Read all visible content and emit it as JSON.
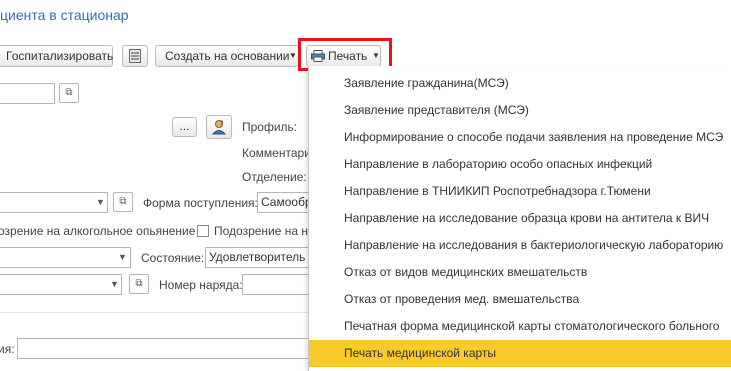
{
  "header": {
    "title_link": "циента в стационар"
  },
  "toolbar": {
    "hospitalize_label": "Госпитализировать",
    "create_based_label": "Создать на основании",
    "print_label": "Печать"
  },
  "form": {
    "profile_label": "Профиль:",
    "comment_label": "Комментари",
    "department_label": "Отделение:",
    "admission_form_label": "Форма поступления:",
    "admission_form_value": "Самообр",
    "alcohol_text": "озрение на алкогольное опьянение",
    "suspicion_text": "Подозрение на на",
    "state_label": "Состояние:",
    "state_value": "Удовлетворитель",
    "order_number_label": "Номер наряда:",
    "bottom_label": "ия:",
    "ellipsis": "..."
  },
  "print_menu": {
    "items": [
      "Заявление гражданина(МСЭ)",
      "Заявление представителя (МСЭ)",
      "Информирование о способе подачи заявления на проведение МСЭ",
      "Направление в лабораторию особо опасных инфекций",
      "Направление в ТНИИКИП Роспотребнадзора г.Тюмени",
      "Направление на исследование образца крови на антитела к ВИЧ",
      "Направление на исследования в бактериологическую лабораторию",
      "Отказ от видов медицинских вмешательств",
      "Отказ от проведения мед. вмешательства",
      "Печатная форма медицинской карты стоматологического больного",
      "Печать медицинской карты"
    ],
    "selected_index": 10
  },
  "colors": {
    "highlight": "#f6cb2a",
    "link": "#3a6cb0",
    "callout": "#e8141c"
  }
}
